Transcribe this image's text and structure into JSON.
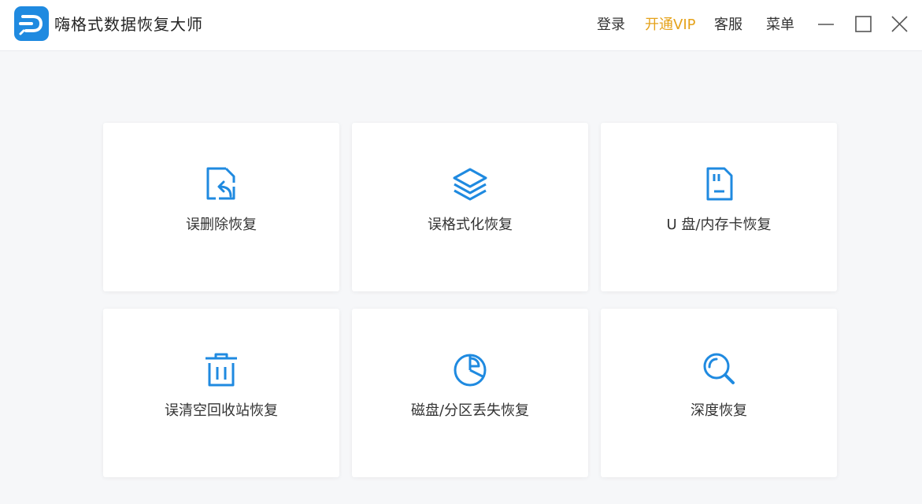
{
  "header": {
    "app_title": "嗨格式数据恢复大师",
    "logo_icon": "app-logo-icon",
    "menu": {
      "login": "登录",
      "vip": "开通VIP",
      "service": "客服",
      "more": "菜单"
    },
    "window_controls": [
      "minimize-icon",
      "maximize-icon",
      "close-icon"
    ]
  },
  "colors": {
    "accent": "#1f8ae0",
    "vip": "#e5a21a",
    "background": "#f6f7f9",
    "card": "#ffffff",
    "text": "#333333"
  },
  "cards": [
    {
      "label": "误删除恢复",
      "icon": "deleted-file-restore-icon"
    },
    {
      "label": "误格式化恢复",
      "icon": "layers-icon"
    },
    {
      "label": "U 盘/内存卡恢复",
      "icon": "memory-card-icon"
    },
    {
      "label": "误清空回收站恢复",
      "icon": "trash-icon"
    },
    {
      "label": "磁盘/分区丢失恢复",
      "icon": "pie-chart-icon"
    },
    {
      "label": "深度恢复",
      "icon": "magnifier-icon"
    }
  ]
}
